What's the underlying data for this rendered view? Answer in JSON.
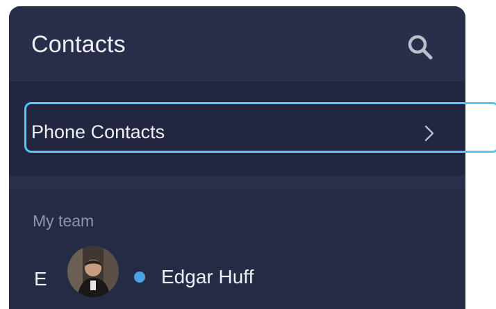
{
  "header": {
    "title": "Contacts",
    "search_icon": "search-icon"
  },
  "phone_contacts": {
    "label": "Phone Contacts",
    "chevron_icon": "chevron-right-icon"
  },
  "team_section": {
    "label": "My team",
    "contacts": [
      {
        "index_letter": "E",
        "name": "Edgar Huff",
        "status_color": "#4aa3e4"
      }
    ]
  },
  "colors": {
    "panel_bg": "#252a45",
    "header_bg": "#292e4a",
    "highlight": "#5cc3f7"
  }
}
